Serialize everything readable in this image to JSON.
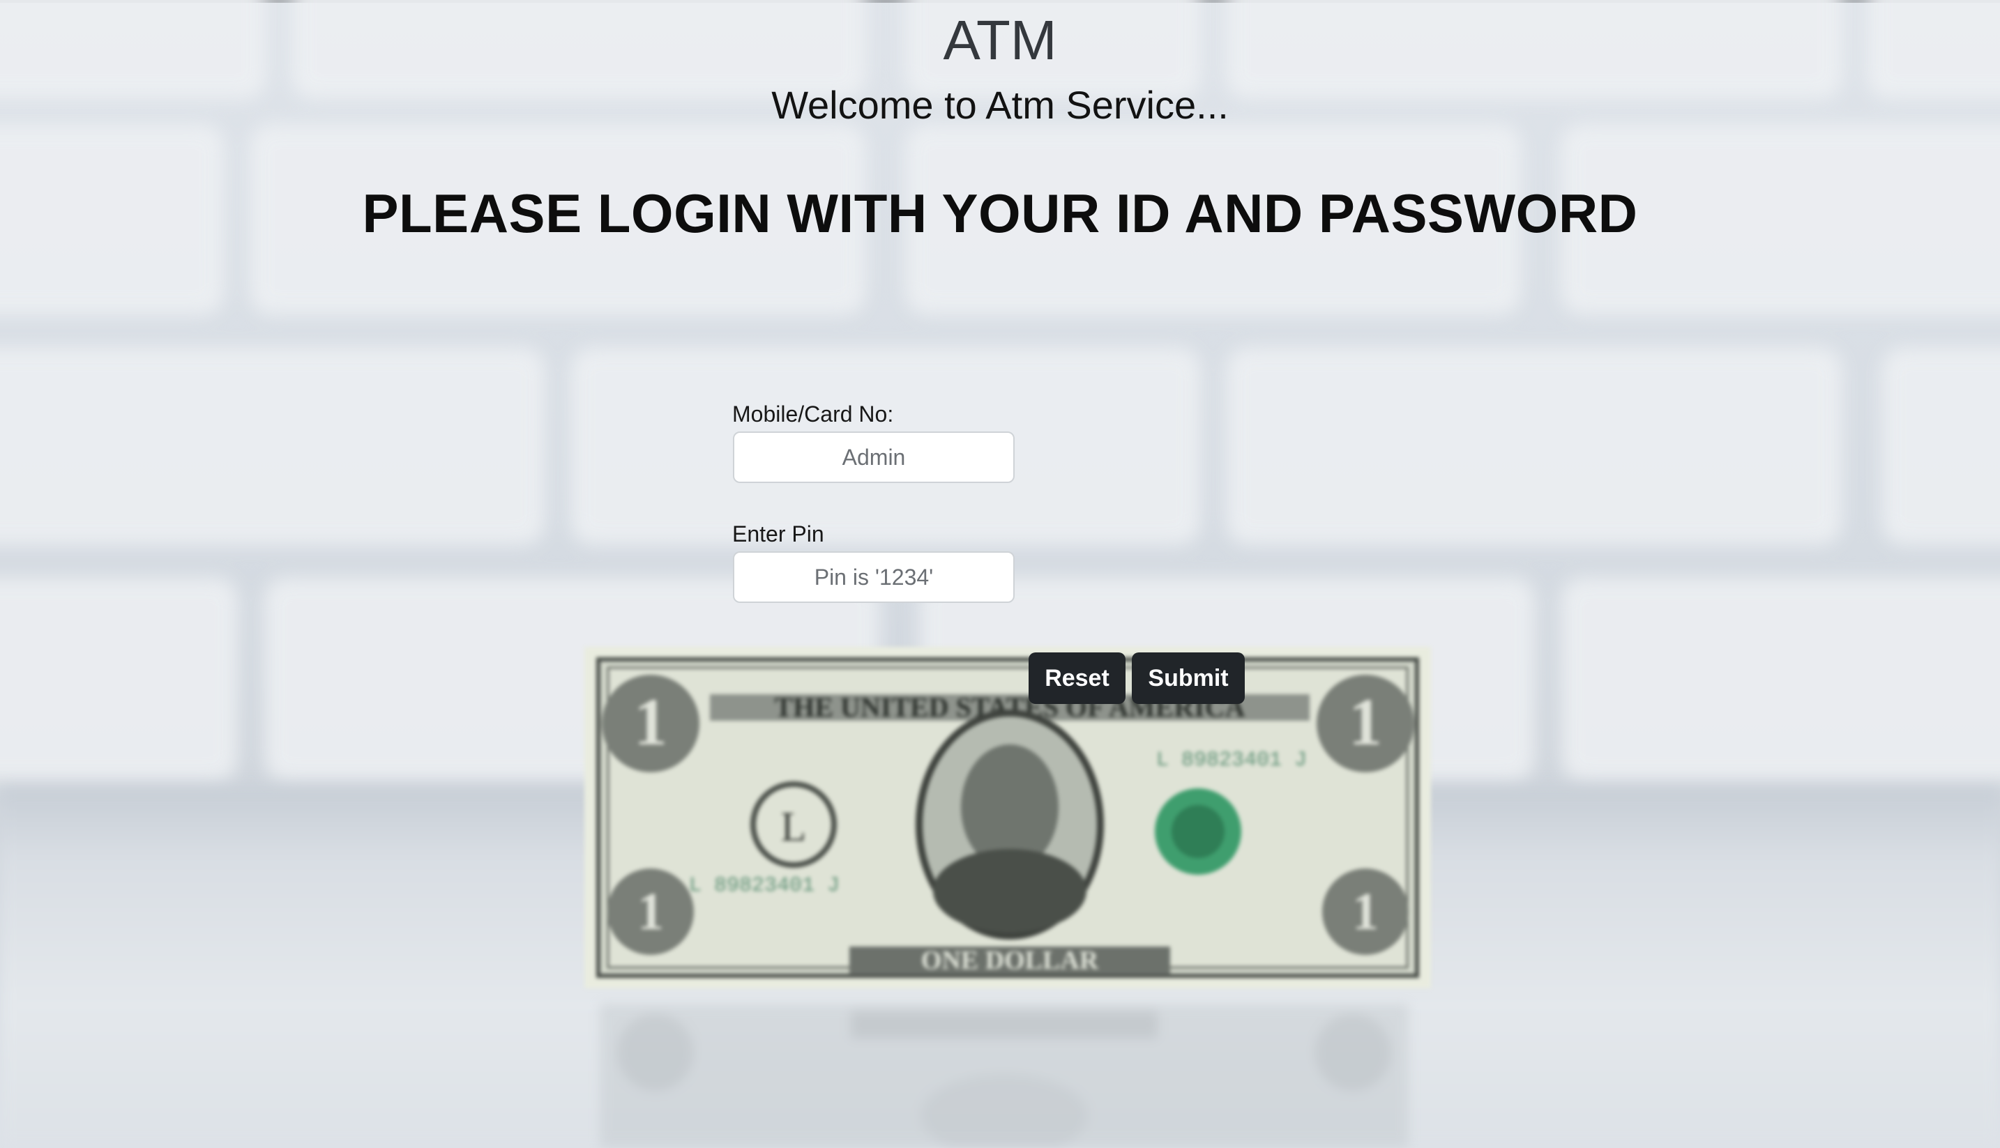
{
  "header": {
    "title": "ATM",
    "welcome": "Welcome to Atm Service..."
  },
  "login": {
    "heading": "PLEASE LOGIN WITH YOUR ID AND PASSWORD"
  },
  "form": {
    "card_label": "Mobile/Card No:",
    "card_placeholder": "Admin",
    "card_value": "",
    "pin_label": "Enter Pin",
    "pin_placeholder": "Pin is '1234'",
    "pin_value": "",
    "reset_label": "Reset",
    "submit_label": "Submit"
  },
  "background": {
    "image": "dollar-bill-on-table-in-front-of-white-brick-wall",
    "bill_text": "THE UNITED STATES OF AMERICA",
    "bill_denomination": "ONE DOLLAR",
    "bill_serial": "L 89823401 J"
  },
  "colors": {
    "button_bg": "#212529",
    "button_text": "#ffffff",
    "heading_text": "#0d0d0d",
    "title_text": "#34383d",
    "input_border": "#cfd3d7"
  }
}
